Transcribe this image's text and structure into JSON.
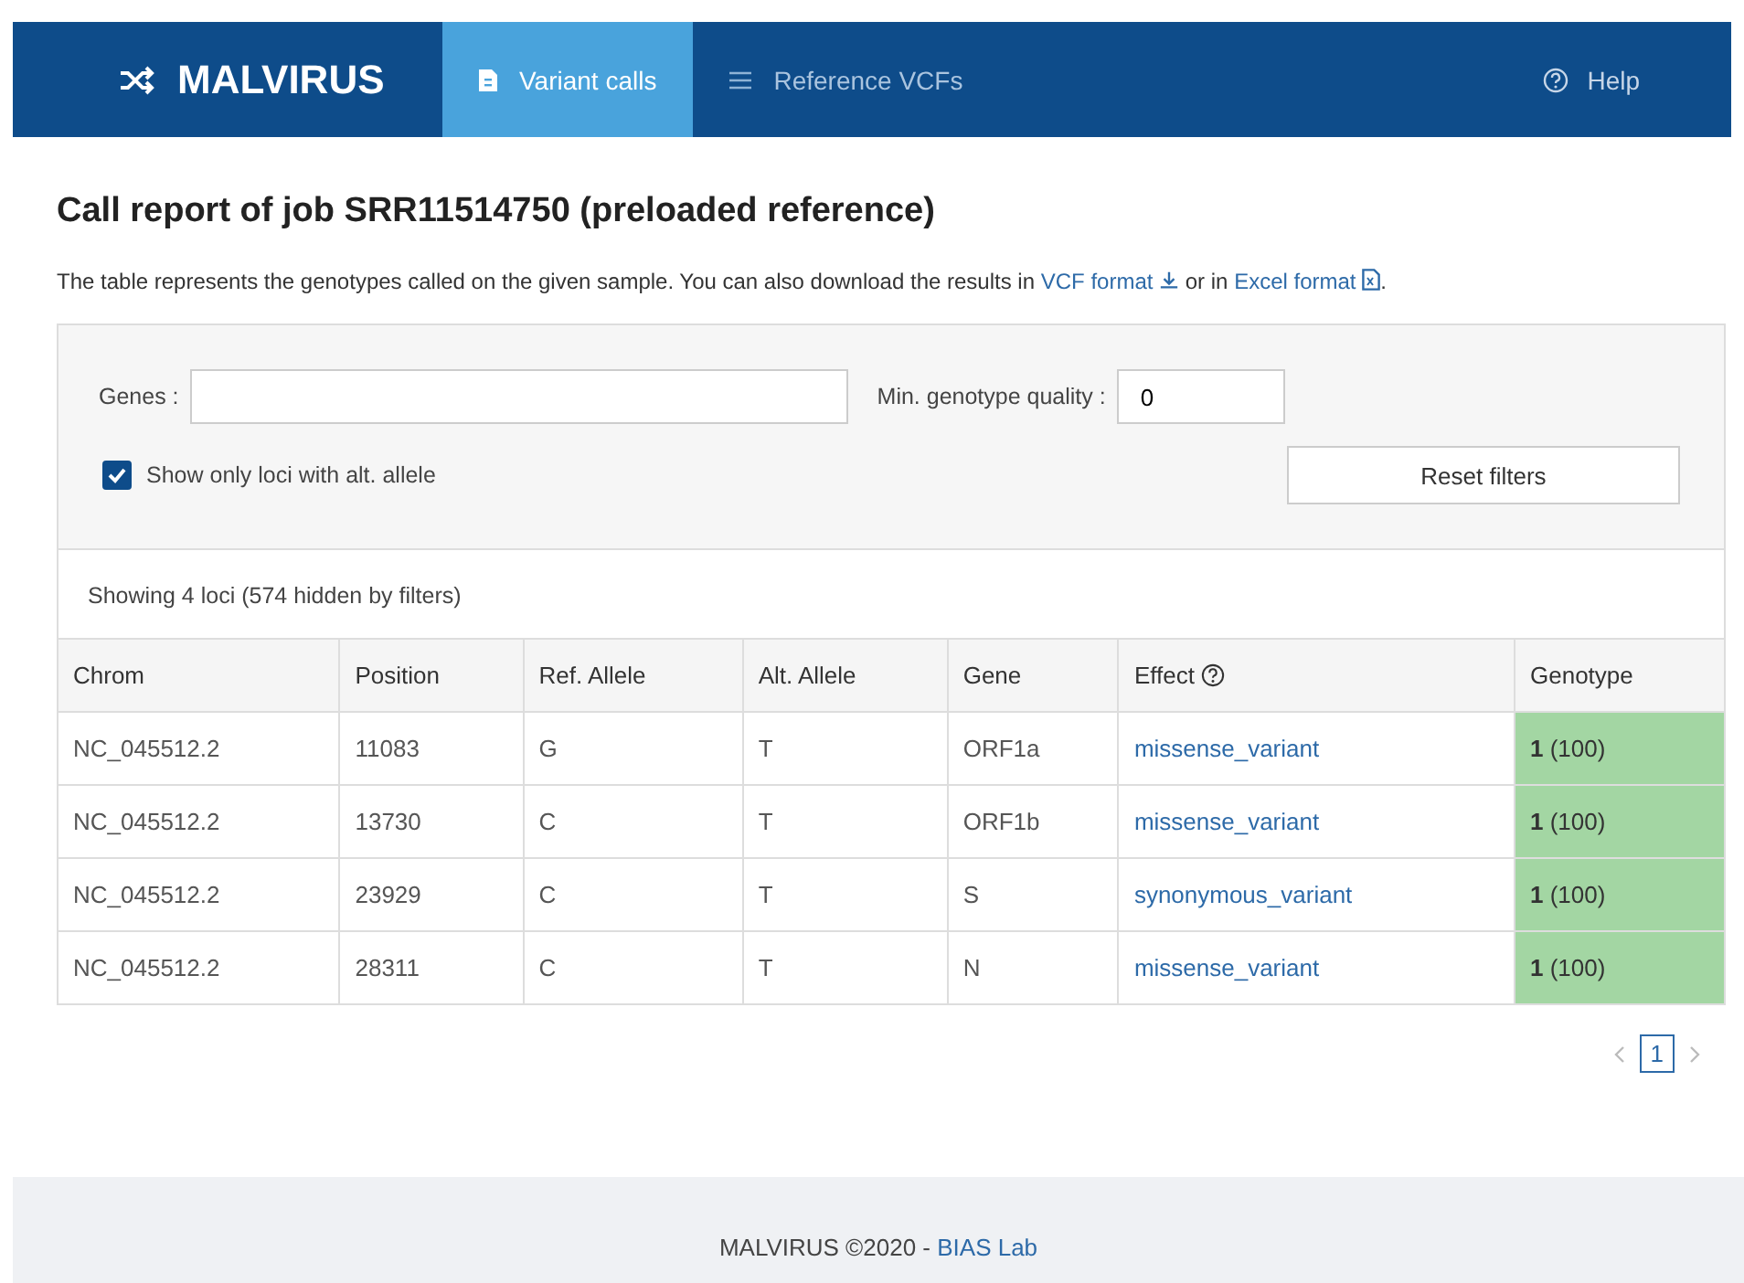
{
  "navbar": {
    "brand": "MALVIRUS",
    "tabs": [
      {
        "label": "Variant calls",
        "kind": "document",
        "selected": true
      },
      {
        "label": "Reference VCFs",
        "kind": "list",
        "selected": false
      }
    ],
    "help": "Help"
  },
  "title": "Call report of job SRR11514750 (preloaded reference)",
  "description": {
    "before": "The table represents the genotypes called on the given sample. You can also download the results in",
    "vcf_link": "VCF format",
    "middle": "or in",
    "excel_link": "Excel format",
    "end": "."
  },
  "filters": {
    "genes_label": "Genes :",
    "min_quality_label": "Min. genotype quality :",
    "min_quality_value": "0",
    "alt_only": {
      "label": "Show only loci with alt. allele",
      "checked": true
    },
    "reset_button": "Reset filters"
  },
  "summary": "Showing 4 loci (574 hidden by filters)",
  "table": {
    "columns": [
      "Chrom",
      "Position",
      "Ref. Allele",
      "Alt. Allele",
      "Gene",
      "Effect",
      "Genotype"
    ],
    "rows": [
      [
        "NC_045512.2",
        "11083",
        "G",
        "T",
        "ORF1a",
        "missense_variant",
        "**1** (100)"
      ],
      [
        "NC_045512.2",
        "13730",
        "C",
        "T",
        "ORF1b",
        "missense_variant",
        "**1** (100)"
      ],
      [
        "NC_045512.2",
        "23929",
        "C",
        "T",
        "S",
        "synonymous_variant",
        "**1** (100)"
      ],
      [
        "NC_045512.2",
        "28311",
        "C",
        "T",
        "N",
        "missense_variant",
        "**1** (100)"
      ]
    ]
  },
  "pagination": {
    "pages": [
      {
        "label": "1",
        "selected": true
      }
    ]
  },
  "footer": {
    "text": "MALVIRUS ©2020 -",
    "link": "BIAS Lab"
  }
}
